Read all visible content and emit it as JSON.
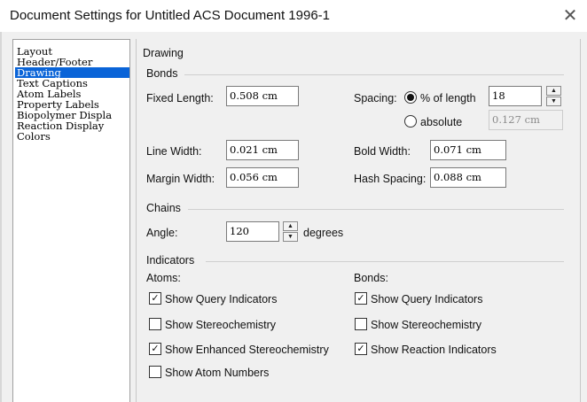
{
  "window": {
    "title": "Document Settings for Untitled ACS Document 1996-1",
    "close_glyph": "✕"
  },
  "sidebar": {
    "items": [
      {
        "label": "Layout"
      },
      {
        "label": "Header/Footer"
      },
      {
        "label": "Drawing",
        "selected": true
      },
      {
        "label": "Text Captions"
      },
      {
        "label": "Atom Labels"
      },
      {
        "label": "Property Labels"
      },
      {
        "label": "Biopolymer Displa"
      },
      {
        "label": "Reaction Display"
      },
      {
        "label": "Colors"
      }
    ]
  },
  "drawing": {
    "heading": "Drawing",
    "bonds": {
      "heading": "Bonds",
      "fixed_length_label": "Fixed Length:",
      "fixed_length_value": "0.508 cm",
      "spacing_label": "Spacing:",
      "percent_label": "% of length",
      "percent_value": "18",
      "percent_selected": true,
      "absolute_label": "absolute",
      "absolute_value": "0.127 cm",
      "line_width_label": "Line Width:",
      "line_width_value": "0.021 cm",
      "bold_width_label": "Bold Width:",
      "bold_width_value": "0.071 cm",
      "margin_width_label": "Margin Width:",
      "margin_width_value": "0.056 cm",
      "hash_spacing_label": "Hash Spacing:",
      "hash_spacing_value": "0.088 cm"
    },
    "chains": {
      "heading": "Chains",
      "angle_label": "Angle:",
      "angle_value": "120",
      "degrees_label": "degrees"
    },
    "indicators": {
      "heading": "Indicators",
      "atoms_label": "Atoms:",
      "bonds_label": "Bonds:",
      "atoms": [
        {
          "label": "Show Query Indicators",
          "checked": true
        },
        {
          "label": "Show Stereochemistry",
          "checked": false
        },
        {
          "label": "Show Enhanced Stereochemistry",
          "checked": true
        },
        {
          "label": "Show Atom Numbers",
          "checked": false
        }
      ],
      "bonds": [
        {
          "label": "Show Query Indicators",
          "checked": true
        },
        {
          "label": "Show Stereochemistry",
          "checked": false
        },
        {
          "label": "Show Reaction Indicators",
          "checked": true
        }
      ]
    }
  }
}
